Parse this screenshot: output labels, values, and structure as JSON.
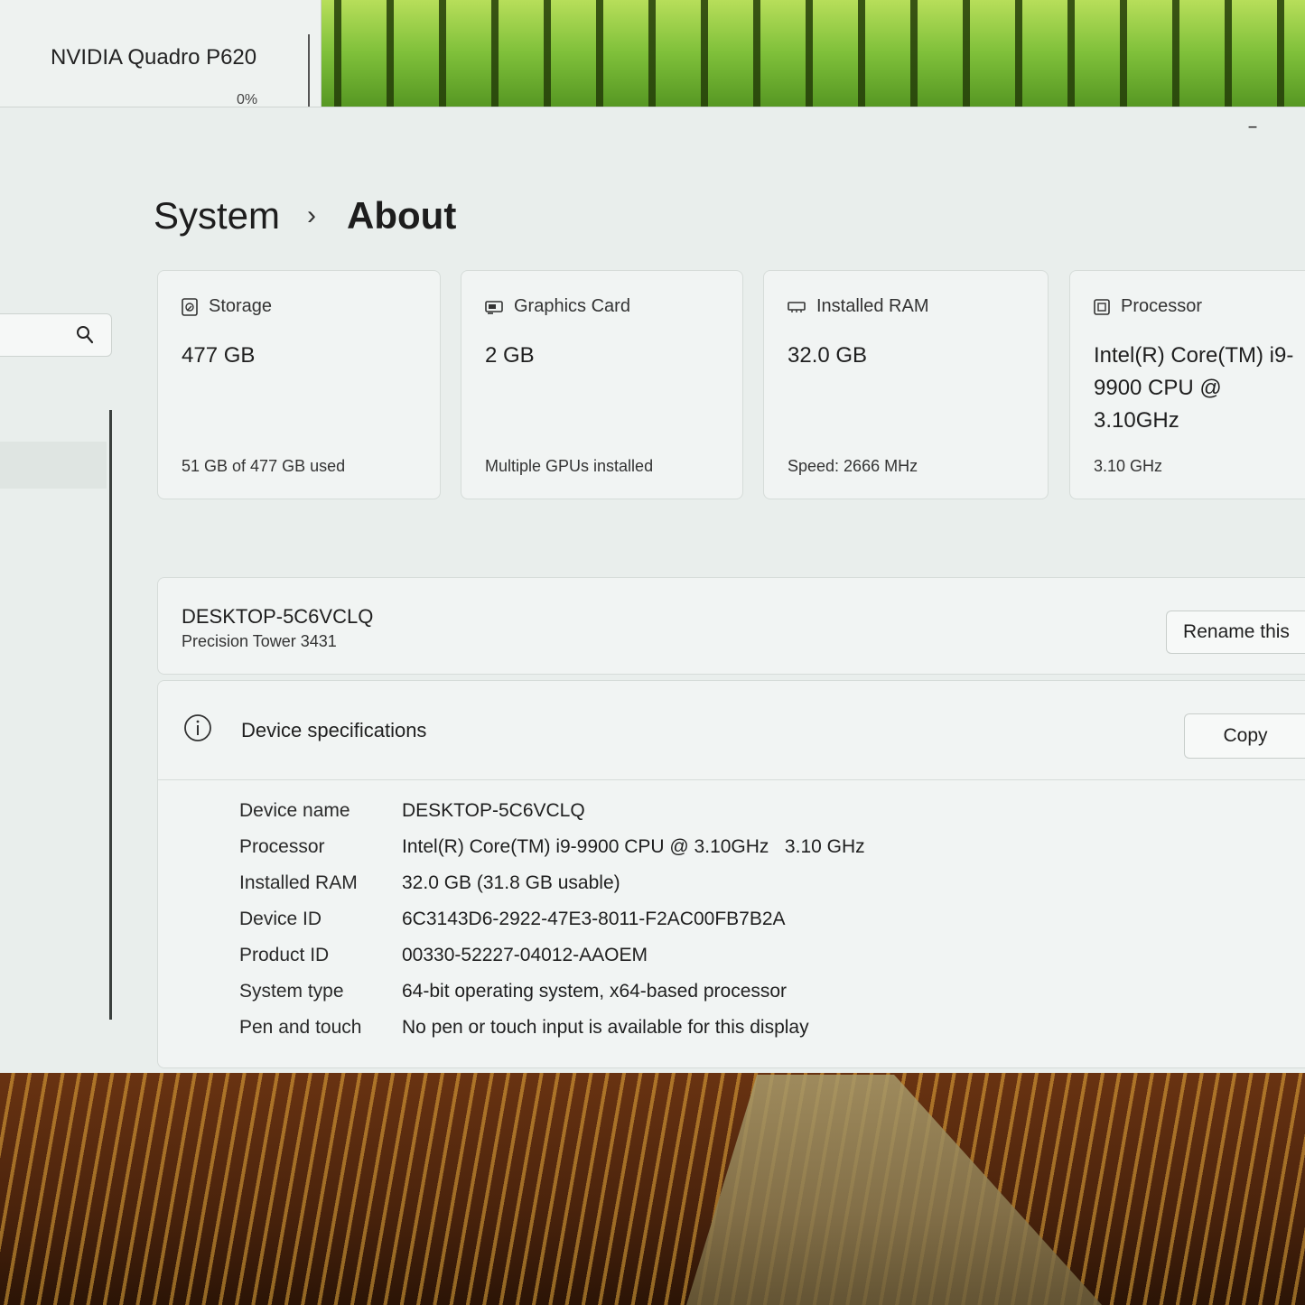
{
  "taskmanager": {
    "gpu_name": "NVIDIA Quadro P620",
    "gpu_usage": "0%"
  },
  "breadcrumb": {
    "parent": "System",
    "separator": "›",
    "current": "About"
  },
  "cards": [
    {
      "title": "Storage",
      "value": "477 GB",
      "sub": "51 GB of 477 GB used",
      "icon": "storage-icon"
    },
    {
      "title": "Graphics Card",
      "value": "2 GB",
      "sub": "Multiple GPUs installed",
      "icon": "graphics-card-icon"
    },
    {
      "title": "Installed RAM",
      "value": "32.0 GB",
      "sub": "Speed: 2666 MHz",
      "icon": "ram-icon"
    },
    {
      "title": "Processor",
      "value": "Intel(R) Core(TM) i9-9900 CPU @ 3.10GHz",
      "sub": "3.10 GHz",
      "icon": "processor-icon"
    }
  ],
  "device": {
    "name": "DESKTOP-5C6VCLQ",
    "model": "Precision Tower 3431",
    "rename_label": "Rename this"
  },
  "specs": {
    "title": "Device specifications",
    "copy_label": "Copy",
    "rows": [
      {
        "label": "Device name",
        "value": "DESKTOP-5C6VCLQ"
      },
      {
        "label": "Processor",
        "value": "Intel(R) Core(TM) i9-9900 CPU @ 3.10GHz   3.10 GHz"
      },
      {
        "label": "Installed RAM",
        "value": "32.0 GB (31.8 GB usable)"
      },
      {
        "label": "Device ID",
        "value": "6C3143D6-2922-47E3-8011-F2AC00FB7B2A"
      },
      {
        "label": "Product ID",
        "value": "00330-52227-04012-AAOEM"
      },
      {
        "label": "System type",
        "value": "64-bit operating system, x64-based processor"
      },
      {
        "label": "Pen and touch",
        "value": "No pen or touch input is available for this display"
      }
    ]
  },
  "colors": {
    "window_bg": "#e9eeec",
    "card_bg": "#f1f4f3"
  }
}
